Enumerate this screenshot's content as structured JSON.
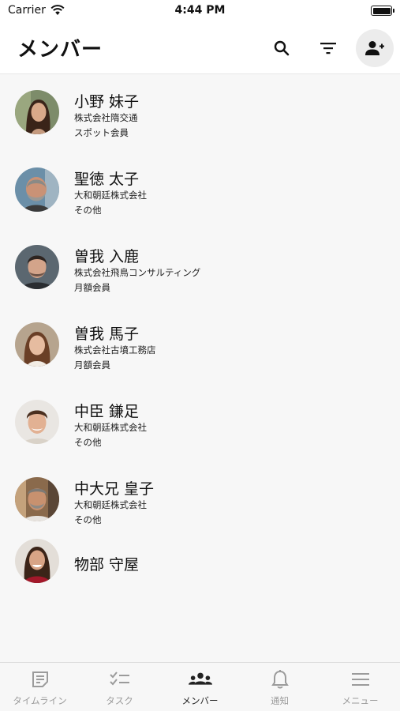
{
  "status_bar": {
    "carrier": "Carrier",
    "time": "4:44 PM"
  },
  "header": {
    "title": "メンバー"
  },
  "members": [
    {
      "name": "小野 妹子",
      "company": "株式会社隋交通",
      "plan": "スポット会員"
    },
    {
      "name": "聖徳 太子",
      "company": "大和朝廷株式会社",
      "plan": "その他"
    },
    {
      "name": "曽我 入鹿",
      "company": "株式会社飛鳥コンサルティング",
      "plan": "月額会員"
    },
    {
      "name": "曽我 馬子",
      "company": "株式会社古墳工務店",
      "plan": "月額会員"
    },
    {
      "name": "中臣 鎌足",
      "company": "大和朝廷株式会社",
      "plan": "その他"
    },
    {
      "name": "中大兄 皇子",
      "company": "大和朝廷株式会社",
      "plan": "その他"
    },
    {
      "name": "物部 守屋"
    }
  ],
  "tabs": [
    {
      "label": "タイムライン",
      "icon": "timeline-icon",
      "active": false
    },
    {
      "label": "タスク",
      "icon": "task-checklist-icon",
      "active": false
    },
    {
      "label": "メンバー",
      "icon": "members-icon",
      "active": true
    },
    {
      "label": "通知",
      "icon": "bell-icon",
      "active": false
    },
    {
      "label": "メニュー",
      "icon": "menu-icon",
      "active": false
    }
  ],
  "colors": {
    "active_tab": "#222222",
    "inactive_tab": "#9b9b9b",
    "background": "#f7f7f7"
  }
}
